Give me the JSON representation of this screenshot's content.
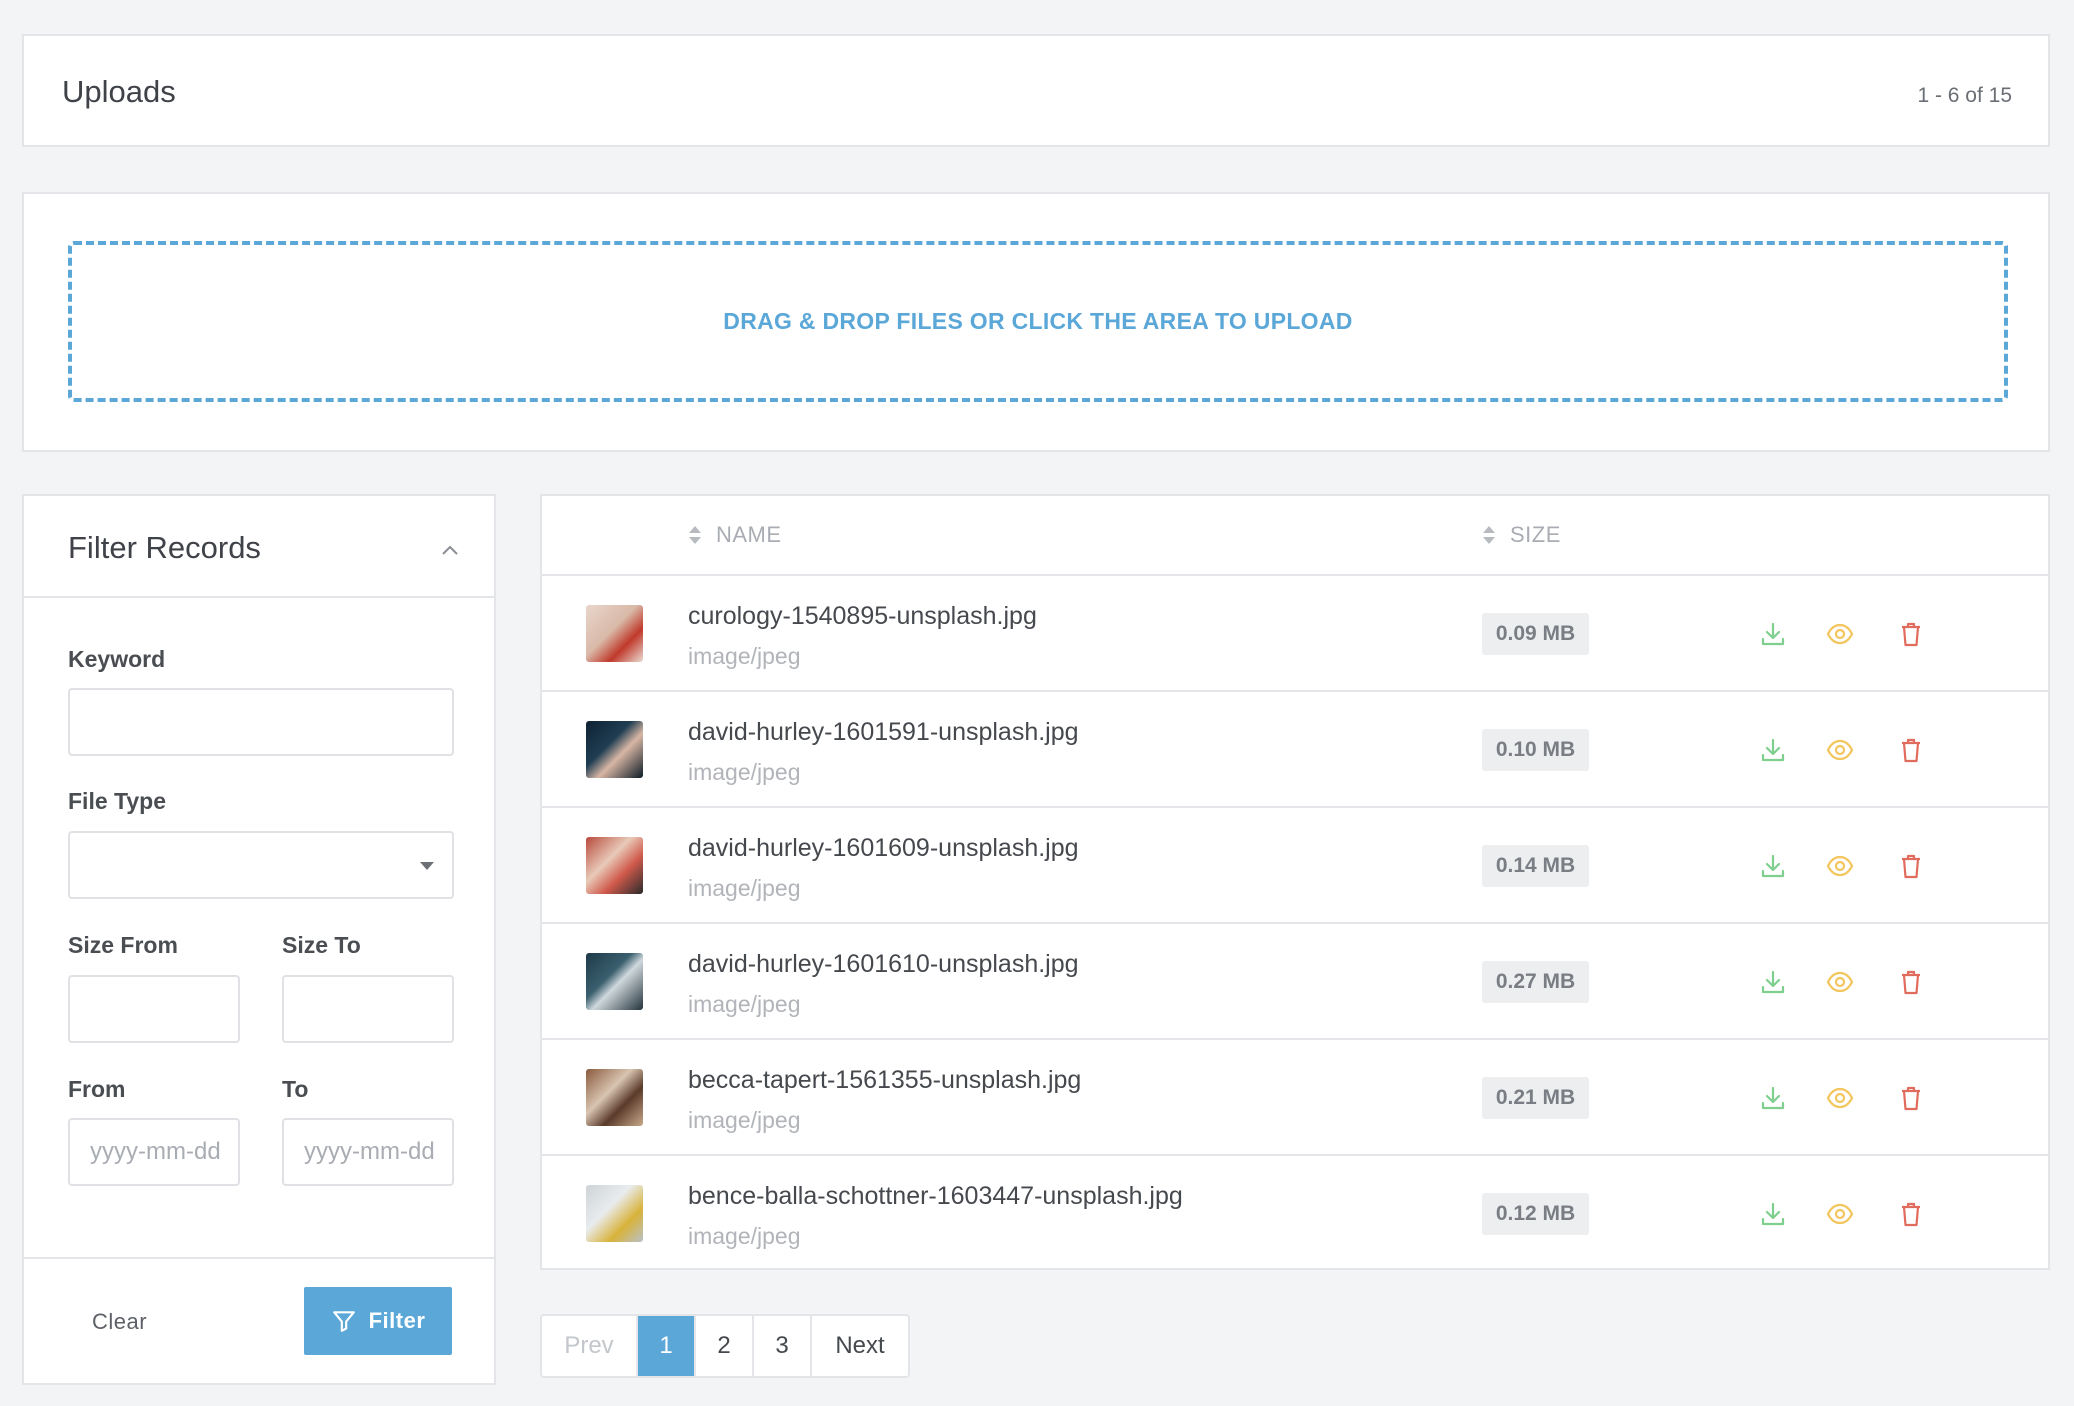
{
  "header": {
    "title": "Uploads",
    "record_count": "1 - 6 of 15"
  },
  "upload": {
    "dropzone_label": "DRAG & DROP FILES OR CLICK THE AREA TO UPLOAD"
  },
  "filter": {
    "title": "Filter Records",
    "keyword_label": "Keyword",
    "keyword_value": "",
    "file_type_label": "File Type",
    "file_type_value": "",
    "size_from_label": "Size From",
    "size_to_label": "Size To",
    "from_label": "From",
    "to_label": "To",
    "from_placeholder": "yyyy-mm-dd",
    "to_placeholder": "yyyy-mm-dd",
    "clear_label": "Clear",
    "filter_label": "Filter"
  },
  "table": {
    "columns": {
      "name": "NAME",
      "size": "SIZE"
    },
    "rows": [
      {
        "name": "curology-1540895-unsplash.jpg",
        "type": "image/jpeg",
        "size": "0.09 MB"
      },
      {
        "name": "david-hurley-1601591-unsplash.jpg",
        "type": "image/jpeg",
        "size": "0.10 MB"
      },
      {
        "name": "david-hurley-1601609-unsplash.jpg",
        "type": "image/jpeg",
        "size": "0.14 MB"
      },
      {
        "name": "david-hurley-1601610-unsplash.jpg",
        "type": "image/jpeg",
        "size": "0.27 MB"
      },
      {
        "name": "becca-tapert-1561355-unsplash.jpg",
        "type": "image/jpeg",
        "size": "0.21 MB"
      },
      {
        "name": "bence-balla-schottner-1603447-unsplash.jpg",
        "type": "image/jpeg",
        "size": "0.12 MB"
      }
    ]
  },
  "pagination": {
    "prev": "Prev",
    "pages": [
      "1",
      "2",
      "3"
    ],
    "current_page": "1",
    "next": "Next"
  },
  "colors": {
    "accent": "#5aa7d8",
    "download": "#7fcf8e",
    "view": "#f3c55a",
    "delete": "#e06c5d"
  },
  "icons": {
    "download": "download-icon",
    "view": "eye-icon",
    "delete": "trash-icon",
    "filter": "funnel-icon",
    "collapse": "chevron-up-icon",
    "sort": "sort-icon"
  }
}
